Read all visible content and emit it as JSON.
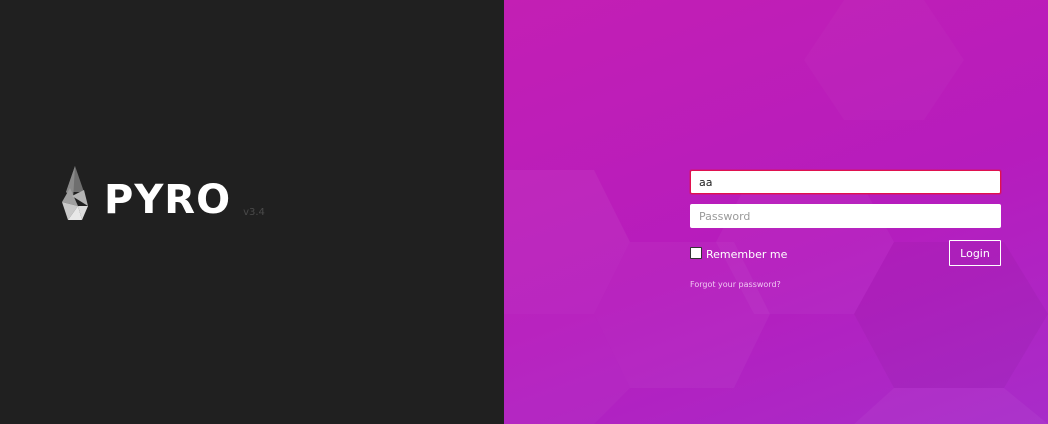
{
  "brand": {
    "name": "PYRO",
    "version": "v3.4"
  },
  "login": {
    "username_value": "aa",
    "password_placeholder": "Password",
    "remember_label": "Remember me",
    "login_label": "Login",
    "forgot_label": "Forgot your password?"
  },
  "colors": {
    "left_background": "#202020",
    "right_gradient_start": "#c31fb4",
    "right_gradient_end": "#a82cc9",
    "username_focus_border": "#e0114e"
  },
  "icons": {
    "logo": "flame-logo-icon"
  }
}
